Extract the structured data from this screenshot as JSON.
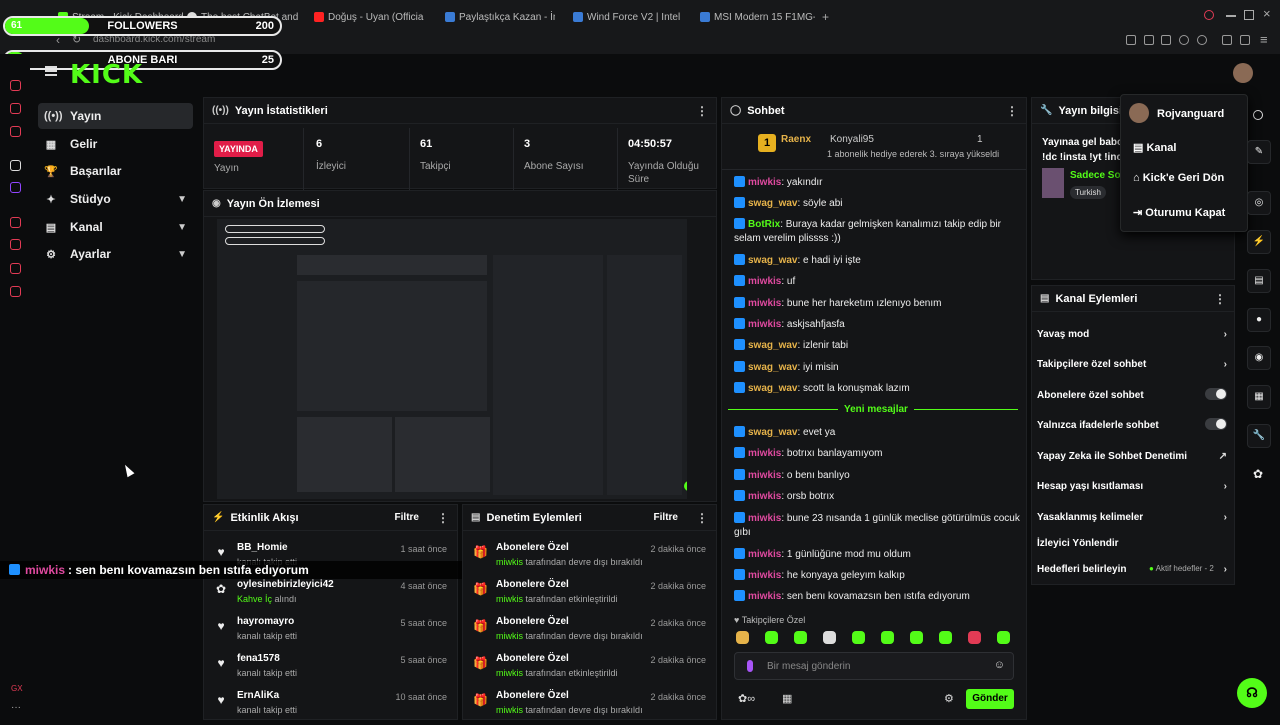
{
  "browser": {
    "tabs": [
      {
        "label": "Stream - Kick Dashboard",
        "color": "#53fc18"
      },
      {
        "label": "The best ChatBot and W",
        "color": "#dddddd"
      },
      {
        "label": "Doğuş - Uyan (Officia",
        "color": "#ff2222"
      },
      {
        "label": "Paylaştıkça Kazan - İnce",
        "color": "#3a7bd5"
      },
      {
        "label": "Wind Force V2 | Intel i5-1",
        "color": "#3a7bd5"
      },
      {
        "label": "MSI Modern 15 F1MG-633",
        "color": "#3a7bd5"
      }
    ],
    "new_tab": "+",
    "url": "dashboard.kick.com/stream"
  },
  "overlay": {
    "followers_label": "FOLLOWERS",
    "followers_current": "61",
    "followers_goal": "200",
    "followers_progress": 0.305,
    "subs_label": "ABONE BARI",
    "subs_current": "0",
    "subs_goal": "25",
    "subs_progress": 0.0,
    "caption_user": "miwkis",
    "caption_text": ": sen benı kovamazsın ben ıstıfa edıyorum"
  },
  "logo": "KICK",
  "nav": [
    {
      "label": "Yayın",
      "icon": "((•))"
    },
    {
      "label": "Gelir",
      "icon": "▦"
    },
    {
      "label": "Başarılar",
      "icon": "🏆"
    },
    {
      "label": "Stüdyo",
      "icon": "✦"
    },
    {
      "label": "Kanal",
      "icon": "▤"
    },
    {
      "label": "Ayarlar",
      "icon": "⚙"
    }
  ],
  "stats_panel": {
    "title": "Yayın İstatistikleri",
    "live_badge": "YAYINDA",
    "live_label": "Yayın",
    "items": [
      {
        "value": "6",
        "label": "İzleyici"
      },
      {
        "value": "61",
        "label": "Takipçi"
      },
      {
        "value": "3",
        "label": "Abone Sayısı"
      },
      {
        "value": "04:50:57",
        "label": "Yayında Olduğu Süre"
      }
    ]
  },
  "preview_panel": {
    "title": "Yayın Ön İzlemesi"
  },
  "activity": {
    "title": "Etkinlik Akışı",
    "filter": "Filtre",
    "rows": [
      {
        "name": "BB_Homie",
        "sub": "kanalı takip etti",
        "time": "1 saat önce",
        "icon": "♥"
      },
      {
        "name": "oylesinebirizleyici42",
        "sub_green": "Kahve İç",
        "sub": " alındı",
        "time": "4 saat önce",
        "icon": "✿"
      },
      {
        "name": "hayromayro",
        "sub": "kanalı takip etti",
        "time": "5 saat önce",
        "icon": "♥"
      },
      {
        "name": "fena1578",
        "sub": "kanalı takip etti",
        "time": "5 saat önce",
        "icon": "♥"
      },
      {
        "name": "ErnAliKa",
        "sub": "kanalı takip etti",
        "time": "10 saat önce",
        "icon": "♥"
      }
    ]
  },
  "moderation": {
    "title": "Denetim Eylemleri",
    "filter": "Filtre",
    "rows": [
      {
        "name": "Abonelere Özel",
        "user": "miwkis",
        "sub": " tarafından devre dışı bırakıldı",
        "time": "2 dakika önce"
      },
      {
        "name": "Abonelere Özel",
        "user": "miwkis",
        "sub": " tarafından etkinleştirildi",
        "time": "2 dakika önce"
      },
      {
        "name": "Abonelere Özel",
        "user": "miwkis",
        "sub": " tarafından devre dışı bırakıldı",
        "time": "2 dakika önce"
      },
      {
        "name": "Abonelere Özel",
        "user": "miwkis",
        "sub": " tarafından etkinleştirildi",
        "time": "2 dakika önce"
      },
      {
        "name": "Abonelere Özel",
        "user": "miwkis",
        "sub": " tarafından devre dışı bırakıldı",
        "time": "2 dakika önce"
      }
    ]
  },
  "chat": {
    "title": "Sohbet",
    "pinned": {
      "gifter": "Raenx",
      "rank": "1",
      "user": "Konyali95",
      "count": "1",
      "text": "1 abonelik hediye ederek 3. sıraya yükseldi"
    },
    "messages": [
      {
        "user": "miwkis",
        "style": "u1",
        "text": ": yakındır"
      },
      {
        "user": "swag_wav",
        "style": "u2",
        "text": ": söyle abi"
      },
      {
        "user": "BotRix",
        "style": "u3",
        "text": ": Buraya kadar gelmişken kanalımızı takip edip bir selam verelim plissss :))"
      },
      {
        "user": "swag_wav",
        "style": "u2",
        "text": ": e hadi iyi işte"
      },
      {
        "user": "miwkis",
        "style": "u1",
        "text": ": uf"
      },
      {
        "user": "miwkis",
        "style": "u1",
        "text": ": bune her hareketım ızlenıyo benım"
      },
      {
        "user": "miwkis",
        "style": "u1",
        "text": ": askjsahfjasfa"
      },
      {
        "user": "swag_wav",
        "style": "u2",
        "text": ": izlenir tabi"
      },
      {
        "user": "swag_wav",
        "style": "u2",
        "text": ": iyi misin"
      },
      {
        "user": "swag_wav",
        "style": "u2",
        "text": ": scott la konuşmak lazım"
      }
    ],
    "new_messages": "Yeni mesajlar",
    "messages2": [
      {
        "user": "swag_wav",
        "style": "u2",
        "text": ": evet ya"
      },
      {
        "user": "miwkis",
        "style": "u1",
        "text": ": botrıxı banlayamıyom"
      },
      {
        "user": "miwkis",
        "style": "u1",
        "text": ": o benı banlıyo"
      },
      {
        "user": "miwkis",
        "style": "u1",
        "text": ": orsb botrıx"
      },
      {
        "user": "miwkis",
        "style": "u1",
        "text": ": bune 23 nısanda 1 günlük meclise götürülmüs cocuk gıbı"
      },
      {
        "user": "miwkis",
        "style": "u1",
        "text": ": 1 günlüğüne mod mu oldum"
      },
      {
        "user": "miwkis",
        "style": "u1",
        "text": ": he konyaya geleyım kalkıp"
      },
      {
        "user": "miwkis",
        "style": "u1",
        "text": ": sen benı kovamazsın ben ıstıfa edıyorum"
      }
    ],
    "followers_only": "Takipçilere Özel",
    "input_placeholder": "Bir mesaj gönderin",
    "send": "Gönder"
  },
  "info_panel": {
    "title": "Yayın bilgisi",
    "line1": "Yayınaa gel babo",
    "line2": "!dc !insta !yt !ince",
    "category": "Sadece Sol",
    "tag": "Turkish"
  },
  "user_menu": {
    "username": "Rojvanguard",
    "items": [
      "Kanal",
      "Kick'e Geri Dön",
      "Oturumu Kapat"
    ]
  },
  "channel_actions": {
    "title": "Kanal Eylemleri",
    "items": [
      {
        "label": "Yavaş mod",
        "type": "chevron"
      },
      {
        "label": "Takipçilere özel sohbet",
        "type": "chevron"
      },
      {
        "label": "Abonelere özel sohbet",
        "type": "toggle"
      },
      {
        "label": "Yalnızca ifadelerle sohbet",
        "type": "toggle"
      },
      {
        "label": "Yapay Zeka ile Sohbet Denetimi",
        "type": "ext"
      },
      {
        "label": "Hesap yaşı kısıtlaması",
        "type": "chevron"
      },
      {
        "label": "Yasaklanmış kelimeler",
        "type": "chevron"
      },
      {
        "label": "İzleyici Yönlendir",
        "type": "none"
      },
      {
        "label": "Hedefleri belirleyin",
        "type": "goal"
      }
    ],
    "goal_status": "Aktif hedefler - 2"
  },
  "colors": {
    "accent": "#53fc18",
    "live": "#e11d48",
    "bg": "#0b0c0d",
    "panel": "#141517"
  }
}
